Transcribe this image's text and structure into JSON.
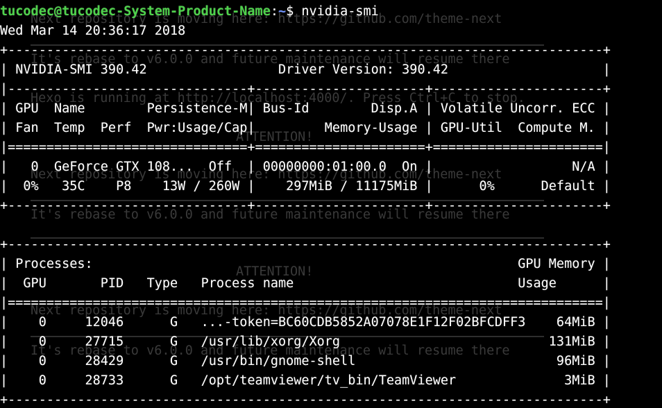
{
  "background_watermark": {
    "lines": [
      "Next repository is moving here: https://github.com/theme-next",
      "It's rebase to v6.0.0 and future maintenance will resume there",
      "Hexo is running at http://localhost:4000/. Press Ctrl+C to stop.",
      "ATTENTION!",
      "Next repository is moving here: https://github.com/theme-next",
      "It's rebase to v6.0.0 and future maintenance will resume there",
      "ATTENTION!",
      "Next repository is moving here: https://github.com/theme-next",
      "It's rebase to v6.0.0 and future maintenance will resume there"
    ]
  },
  "terminal": {
    "prompt": {
      "user_host": "tucodec@tucodec-System-Product-Name",
      "separator": ":",
      "path": "~",
      "symbol": "$ ",
      "command": "nvidia-smi"
    },
    "timestamp": "Wed Mar 14 20:36:17 2018",
    "lines": [
      "+-----------------------------------------------------------------------------+",
      "| NVIDIA-SMI 390.42                 Driver Version: 390.42                    |",
      "|-------------------------------+----------------------+----------------------+",
      "| GPU  Name        Persistence-M| Bus-Id        Disp.A | Volatile Uncorr. ECC |",
      "| Fan  Temp  Perf  Pwr:Usage/Cap|         Memory-Usage | GPU-Util  Compute M. |",
      "|===============================+======================+======================|",
      "|   0  GeForce GTX 108...  Off  | 00000000:01:00.0  On |                  N/A |",
      "|  0%   35C    P8    13W / 260W |    297MiB / 11175MiB |      0%      Default |",
      "+-------------------------------+----------------------+----------------------+",
      "",
      "+-----------------------------------------------------------------------------+",
      "| Processes:                                                       GPU Memory |",
      "|  GPU       PID   Type   Process name                             Usage      |",
      "|=============================================================================|",
      "|    0     12046      G   ...-token=BC60CDB5852A07078E1F12F02BFCDFF3    64MiB |",
      "|    0     27715      G   /usr/lib/xorg/Xorg                           131MiB |",
      "|    0     28429      G   /usr/bin/gnome-shell                          96MiB |",
      "|    0     28733      G   /opt/teamviewer/tv_bin/TeamViewer              3MiB |",
      "+-----------------------------------------------------------------------------+"
    ]
  },
  "colors": {
    "background": "#000000",
    "text": "#ffffff",
    "prompt_user": "#4ed34b",
    "prompt_path": "#6f93ff",
    "watermark": "#3a3a3a"
  }
}
